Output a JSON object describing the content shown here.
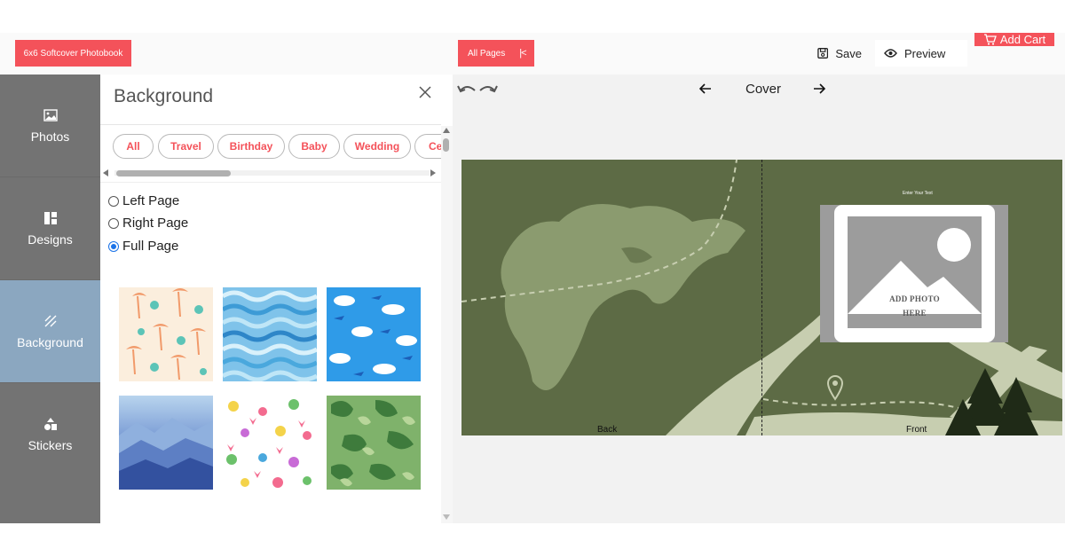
{
  "header": {
    "product_label": "6x6 Softcover Photobook",
    "all_pages_label": "All Pages",
    "save_label": "Save",
    "preview_label": "Preview",
    "add_cart_label": "Add Cart",
    "accent_color": "#f4525a"
  },
  "sidebar": {
    "items": [
      {
        "label": "Photos",
        "icon": "image-icon"
      },
      {
        "label": "Designs",
        "icon": "layout-icon"
      },
      {
        "label": "Background",
        "icon": "hatch-icon",
        "active": true
      },
      {
        "label": "Stickers",
        "icon": "shapes-icon"
      }
    ],
    "active_color": "#8ba7c0"
  },
  "panel": {
    "title": "Background",
    "categories": [
      "All",
      "Travel",
      "Birthday",
      "Baby",
      "Wedding",
      "Ce"
    ],
    "page_options": [
      {
        "label": "Left Page",
        "checked": false
      },
      {
        "label": "Right Page",
        "checked": false
      },
      {
        "label": "Full Page",
        "checked": true
      }
    ],
    "backgrounds": [
      "palm-trees-pattern",
      "blue-waves-pattern",
      "clouds-airplanes-pattern",
      "blue-mountains-pattern",
      "doodle-cupcakes-pattern",
      "green-camouflage-pattern"
    ]
  },
  "canvas": {
    "page_title": "Cover",
    "enter_text": "Enter Your Text",
    "add_photo_line1": "ADD PHOTO",
    "add_photo_line2": "HERE",
    "back_label": "Back",
    "front_label": "Front",
    "spread_color": "#5d6b45"
  }
}
